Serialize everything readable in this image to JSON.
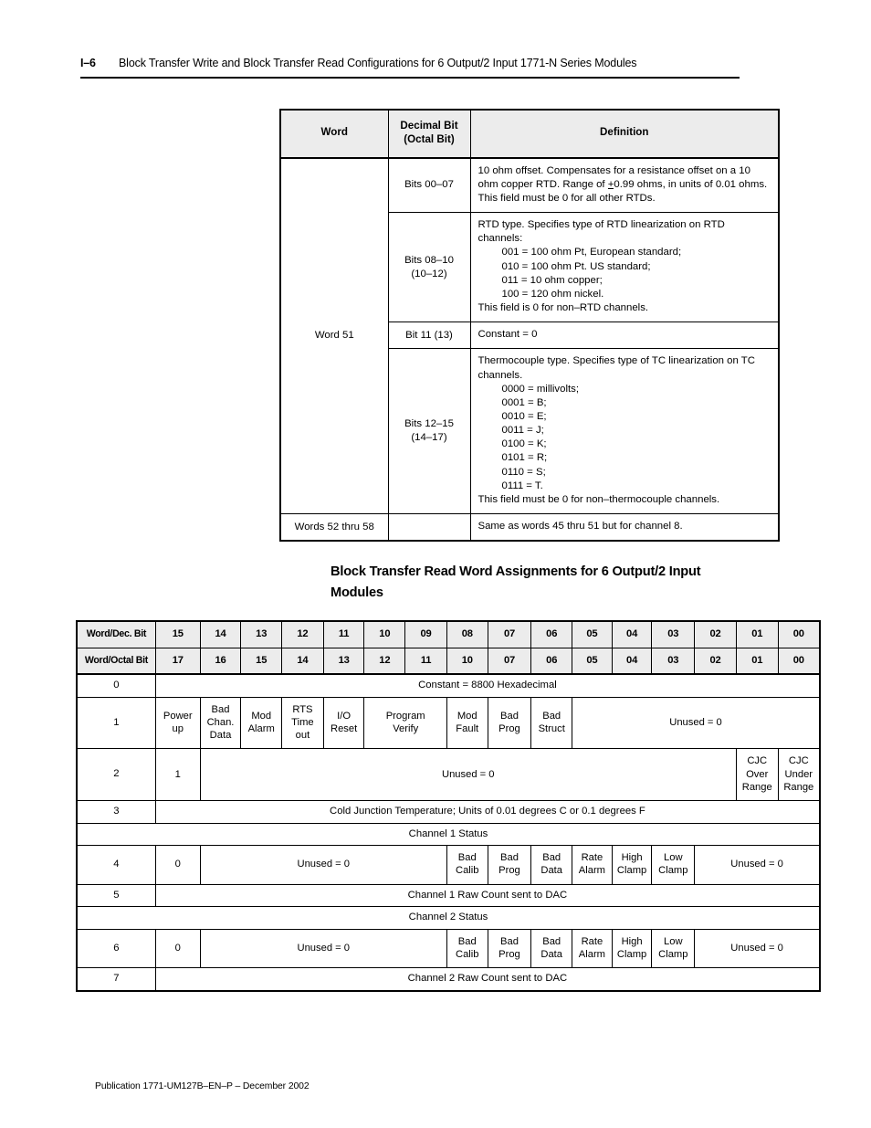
{
  "page_header": {
    "folio": "I–6",
    "title": "Block Transfer Write and Block Transfer Read Configurations for 6 Output/2 Input 1771-N Series Modules"
  },
  "table1": {
    "columns": {
      "word": "Word",
      "bit_line1": "Decimal Bit",
      "bit_line2": "(Octal Bit)",
      "definition": "Definition"
    },
    "word_label": "Word 51",
    "rows": [
      {
        "bit": "Bits 00–07",
        "bit_sub": "",
        "def_lines": [
          "10 ohm offset. Compensates for a resistance offset on a 10",
          "ohm copper RTD. Range of +0.99 ohms, in units of 0.01 ohms.",
          "This field must be 0 for all other RTDs."
        ]
      },
      {
        "bit": "Bits 08–10",
        "bit_sub": "(10–12)",
        "def_lines": [
          "RTD type. Specifies type of RTD linearization on RTD",
          "channels:"
        ],
        "def_indent": [
          "001 = 100 ohm Pt, European standard;",
          "010 = 100 ohm Pt. US standard;",
          "011 = 10 ohm copper;",
          "100 = 120 ohm nickel."
        ],
        "def_tail": [
          "This field is 0 for non–RTD channels."
        ]
      },
      {
        "bit": "Bit 11 (13)",
        "bit_sub": "",
        "def_lines": [
          "Constant = 0"
        ]
      },
      {
        "bit": "Bits 12–15",
        "bit_sub": "(14–17)",
        "def_lines": [
          "Thermocouple type. Specifies type of TC linearization on TC",
          "channels."
        ],
        "def_indent": [
          "0000 = millivolts;",
          "0001 = B;",
          "0010 = E;",
          "0011 = J;",
          "0100 = K;",
          "0101 = R;",
          "0110 = S;",
          "0111 = T."
        ],
        "def_tail": [
          "This field must be 0 for non–thermocouple channels."
        ]
      }
    ],
    "last_row": {
      "word": "Words 52 thru 58",
      "bit": "",
      "definition": "Same as words 45 thru 51 but for channel 8."
    }
  },
  "section_heading": {
    "line1": "Block Transfer Read Word Assignments for 6 Output/2 Input",
    "line2": "Modules"
  },
  "table2": {
    "row_label_dec": "Word/Dec. Bit",
    "row_label_oct": "Word/Octal Bit",
    "decimal_bits": [
      "15",
      "14",
      "13",
      "12",
      "11",
      "10",
      "09",
      "08",
      "07",
      "06",
      "05",
      "04",
      "03",
      "02",
      "01",
      "00"
    ],
    "octal_bits": [
      "17",
      "16",
      "15",
      "14",
      "13",
      "12",
      "11",
      "10",
      "07",
      "06",
      "05",
      "04",
      "03",
      "02",
      "01",
      "00"
    ],
    "rows": [
      {
        "word": "0",
        "cells": [
          {
            "text": "Constant = 8800 Hexadecimal",
            "span": 16
          }
        ]
      },
      {
        "word": "1",
        "tall": true,
        "cells": [
          {
            "text": "Power\nup",
            "span": 1
          },
          {
            "text": "Bad\nChan.\nData",
            "span": 1
          },
          {
            "text": "Mod\nAlarm",
            "span": 1
          },
          {
            "text": "RTS\nTime\nout",
            "span": 1
          },
          {
            "text": "I/O\nReset",
            "span": 1
          },
          {
            "text": "Program\nVerify",
            "span": 2
          },
          {
            "text": "Mod\nFault",
            "span": 1
          },
          {
            "text": "Bad\nProg",
            "span": 1
          },
          {
            "text": "Bad\nStruct",
            "span": 1
          },
          {
            "text": "Unused = 0",
            "span": 6
          }
        ]
      },
      {
        "word": "2",
        "tall": true,
        "cells": [
          {
            "text": "1",
            "span": 1
          },
          {
            "text": "Unused = 0",
            "span": 13
          },
          {
            "text": "CJC\nOver\nRange",
            "span": 1
          },
          {
            "text": "CJC\nUnder\nRange",
            "span": 1
          }
        ]
      },
      {
        "word": "3",
        "cells": [
          {
            "text": "Cold Junction Temperature; Units of 0.01 degrees C or 0.1 degrees F",
            "span": 16
          }
        ]
      },
      {
        "word": "",
        "full": true,
        "cells": [
          {
            "text": "Channel 1 Status",
            "span": 17
          }
        ]
      },
      {
        "word": "4",
        "tall": true,
        "cells": [
          {
            "text": "0",
            "span": 1
          },
          {
            "text": "Unused = 0",
            "span": 6
          },
          {
            "text": "Bad\nCalib",
            "span": 1
          },
          {
            "text": "Bad\nProg",
            "span": 1
          },
          {
            "text": "Bad\nData",
            "span": 1
          },
          {
            "text": "Rate\nAlarm",
            "span": 1
          },
          {
            "text": "High\nClamp",
            "span": 1
          },
          {
            "text": "Low\nClamp",
            "span": 1
          },
          {
            "text": "Unused = 0",
            "span": 3
          }
        ]
      },
      {
        "word": "5",
        "cells": [
          {
            "text": "Channel 1 Raw Count sent to DAC",
            "span": 16
          }
        ]
      },
      {
        "word": "",
        "full": true,
        "cells": [
          {
            "text": "Channel 2 Status",
            "span": 17
          }
        ]
      },
      {
        "word": "6",
        "tall": true,
        "cells": [
          {
            "text": "0",
            "span": 1
          },
          {
            "text": "Unused = 0",
            "span": 6
          },
          {
            "text": "Bad\nCalib",
            "span": 1
          },
          {
            "text": "Bad\nProg",
            "span": 1
          },
          {
            "text": "Bad\nData",
            "span": 1
          },
          {
            "text": "Rate\nAlarm",
            "span": 1
          },
          {
            "text": "High\nClamp",
            "span": 1
          },
          {
            "text": "Low\nClamp",
            "span": 1
          },
          {
            "text": "Unused = 0",
            "span": 3
          }
        ]
      },
      {
        "word": "7",
        "last": true,
        "cells": [
          {
            "text": "Channel 2 Raw Count sent to DAC",
            "span": 16
          }
        ]
      }
    ]
  },
  "footer": "Publication 1771-UM127B–EN–P – December 2002"
}
